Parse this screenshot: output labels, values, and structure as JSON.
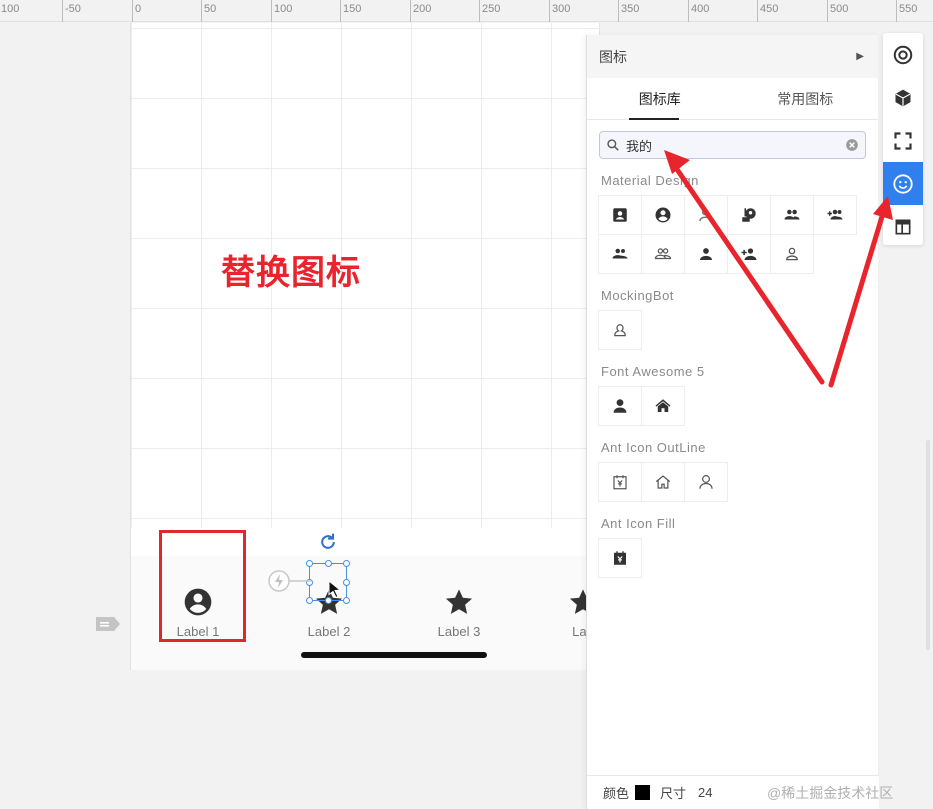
{
  "ruler": {
    "ticks": [
      "100",
      "-50",
      "0",
      "50",
      "100",
      "150",
      "200",
      "250",
      "300",
      "350",
      "400",
      "450",
      "500",
      "550"
    ]
  },
  "canvas": {
    "annotation": "替换图标",
    "tabbar": {
      "items": [
        {
          "label": "Label 1",
          "icon": "account-circle-icon"
        },
        {
          "label": "Label 2",
          "icon": "star-icon"
        },
        {
          "label": "Label 3",
          "icon": "star-icon"
        },
        {
          "label": "Lab",
          "icon": "star-icon"
        }
      ]
    }
  },
  "panel": {
    "title": "图标",
    "tabs": [
      "图标库",
      "常用图标"
    ],
    "search": {
      "value": "我的"
    },
    "sections": [
      {
        "title": "Material Design",
        "icons": [
          "contact-card-icon",
          "account-circle-icon",
          "person-outline-icon",
          "person-pin-icon",
          "people-icon",
          "group-add-icon",
          "people-alt-icon",
          "people-outline-icon",
          "person-icon",
          "person-add-icon",
          "person-outline-alt-icon"
        ]
      },
      {
        "title": "MockingBot",
        "icons": [
          "user-outline-icon"
        ]
      },
      {
        "title": "Font Awesome 5",
        "icons": [
          "user-solid-icon",
          "home-solid-icon"
        ]
      },
      {
        "title": "Ant Icon OutLine",
        "icons": [
          "account-book-icon",
          "home-outline-icon",
          "user-outline-icon"
        ]
      },
      {
        "title": "Ant Icon Fill",
        "icons": [
          "account-book-fill-icon"
        ]
      }
    ],
    "footer": {
      "color_label": "颜色",
      "size_label": "尺寸",
      "size_value": "24",
      "color": "#000000"
    }
  },
  "watermark": "@稀土掘金技术社区",
  "toolbar": {
    "items": [
      "target-icon",
      "cube-icon",
      "frame-icon",
      "emoji-icon",
      "layout-icon"
    ],
    "active": "emoji-icon"
  },
  "colors": {
    "accent": "#2f80ed",
    "annotation_red": "#e8242c"
  }
}
